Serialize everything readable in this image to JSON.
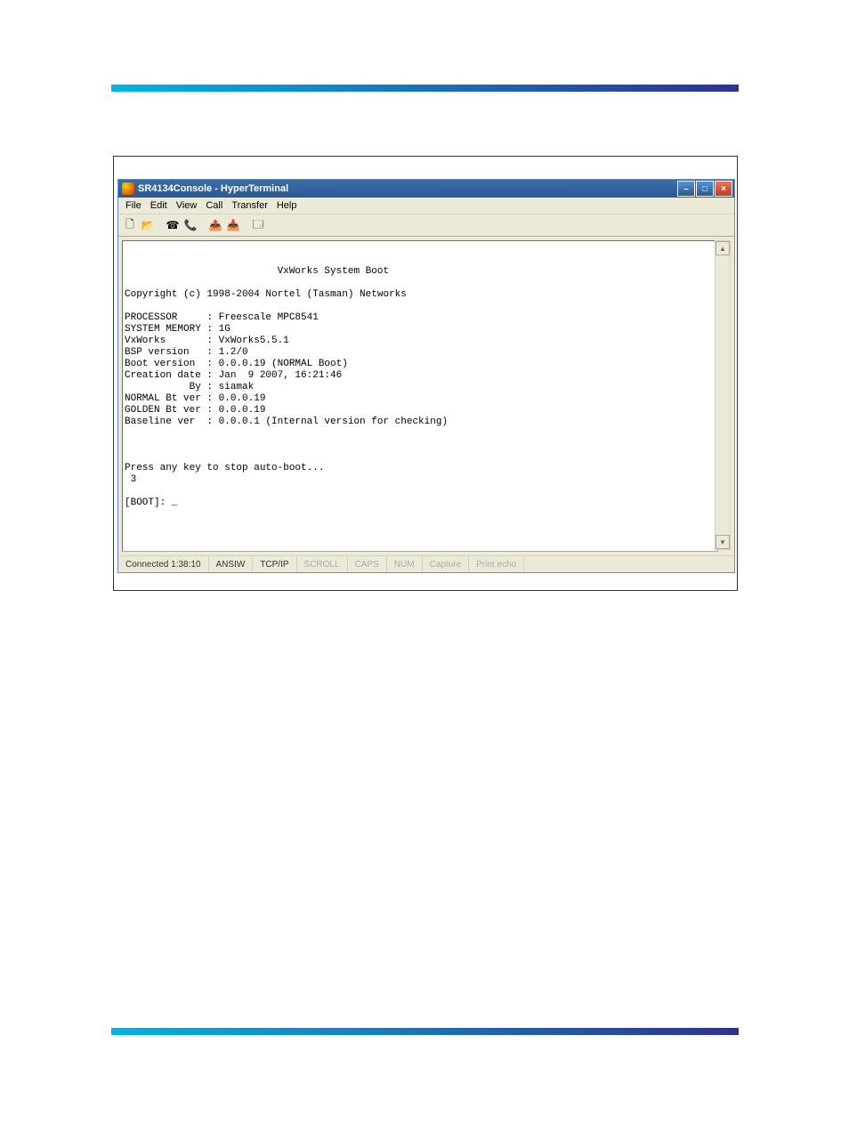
{
  "window": {
    "title": "SR4134Console - HyperTerminal"
  },
  "menubar": {
    "items": [
      "File",
      "Edit",
      "View",
      "Call",
      "Transfer",
      "Help"
    ]
  },
  "toolbar": {
    "icons": [
      "new-doc",
      "open",
      "connect",
      "disconnect",
      "send",
      "receive",
      "properties"
    ]
  },
  "terminal": {
    "title": "VxWorks System Boot",
    "copyright": "Copyright (c) 1998-2004 Nortel (Tasman) Networks",
    "fields": {
      "processor_label": "PROCESSOR",
      "processor_value": "Freescale MPC8541",
      "sysmem_label": "SYSTEM MEMORY",
      "sysmem_value": "1G",
      "vxworks_label": "VxWorks",
      "vxworks_value": "VxWorks5.5.1",
      "bsp_label": "BSP version",
      "bsp_value": "1.2/0",
      "bootver_label": "Boot version",
      "bootver_value": "0.0.0.19 (NORMAL Boot)",
      "creation_label": "Creation date",
      "creation_value": "Jan  9 2007, 16:21:46",
      "by_label": "By",
      "by_value": "siamak",
      "normalbt_label": "NORMAL Bt ver",
      "normalbt_value": "0.0.0.19",
      "goldenbt_label": "GOLDEN Bt ver",
      "goldenbt_value": "0.0.0.19",
      "baseline_label": "Baseline ver",
      "baseline_value": "0.0.0.1 (Internal version for checking)"
    },
    "autoboot": "Press any key to stop auto-boot...",
    "countdown": " 3",
    "prompt": "[BOOT]: _"
  },
  "statusbar": {
    "connected": "Connected 1:38:10",
    "terminal_type": "ANSIW",
    "connection": "TCP/IP",
    "scroll": "SCROLL",
    "caps": "CAPS",
    "num": "NUM",
    "capture": "Capture",
    "printecho": "Print echo"
  }
}
